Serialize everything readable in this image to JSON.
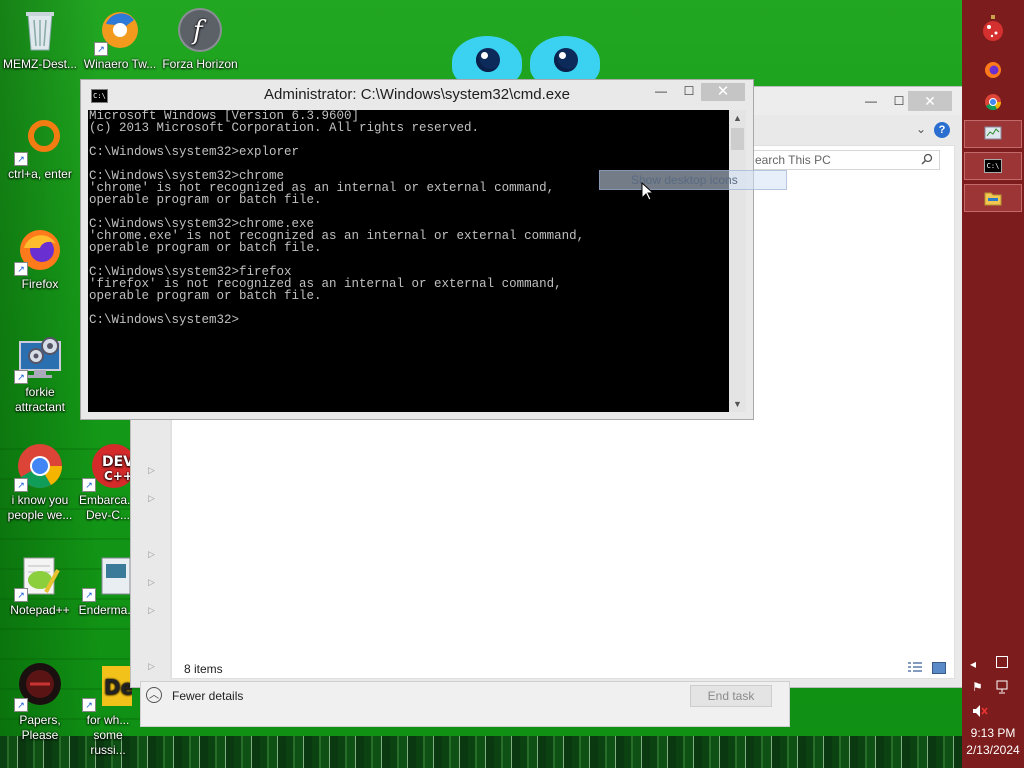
{
  "desktop": {
    "icons": [
      {
        "label": "MEMZ-Dest...",
        "icon": "recycle-bin-icon"
      },
      {
        "label": "Winaero Tw...",
        "icon": "winaero-icon"
      },
      {
        "label": "Forza Horizon",
        "icon": "flash-icon"
      },
      {
        "label": "ctrl+a, enter",
        "icon": "orange-ring-icon"
      },
      {
        "label": "Firefox",
        "icon": "firefox-icon"
      },
      {
        "label": "forkie attractant",
        "icon": "computer-settings-icon"
      },
      {
        "label": "i know you people we...",
        "icon": "chrome-icon"
      },
      {
        "label": "Embarca... Dev-C...",
        "icon": "devcpp-icon"
      },
      {
        "label": "Notepad++",
        "icon": "notepadpp-icon"
      },
      {
        "label": "Enderma...",
        "icon": "enderman-icon"
      },
      {
        "label": "Papers, Please",
        "icon": "papers-please-icon"
      },
      {
        "label": "for wh... some russi...",
        "icon": "dev-icon"
      }
    ]
  },
  "cmd": {
    "title": "Administrator: C:\\Windows\\system32\\cmd.exe",
    "icon_text": "C:\\",
    "output": "Microsoft Windows [Version 6.3.9600]\n(c) 2013 Microsoft Corporation. All rights reserved.\n\nC:\\Windows\\system32>explorer\n\nC:\\Windows\\system32>chrome\n'chrome' is not recognized as an internal or external command,\noperable program or batch file.\n\nC:\\Windows\\system32>chrome.exe\n'chrome.exe' is not recognized as an internal or external command,\noperable program or batch file.\n\nC:\\Windows\\system32>firefox\n'firefox' is not recognized as an internal or external command,\noperable program or batch file.\n\nC:\\Windows\\system32>",
    "minimize": "—",
    "maximize": "☐",
    "close": "✕"
  },
  "explorer": {
    "search_placeholder": "earch This PC",
    "help": "?",
    "items_count": "8 items",
    "close": "✕"
  },
  "tooltip": {
    "text": "Show desktop icons"
  },
  "task_manager": {
    "fewer_details": "Fewer details",
    "end_task": "End task"
  },
  "taskbar": {
    "time": "9:13 PM",
    "date": "2/13/2024"
  },
  "colors": {
    "taskbar": "#7c1c1c",
    "desktop": "#1aa81a"
  }
}
